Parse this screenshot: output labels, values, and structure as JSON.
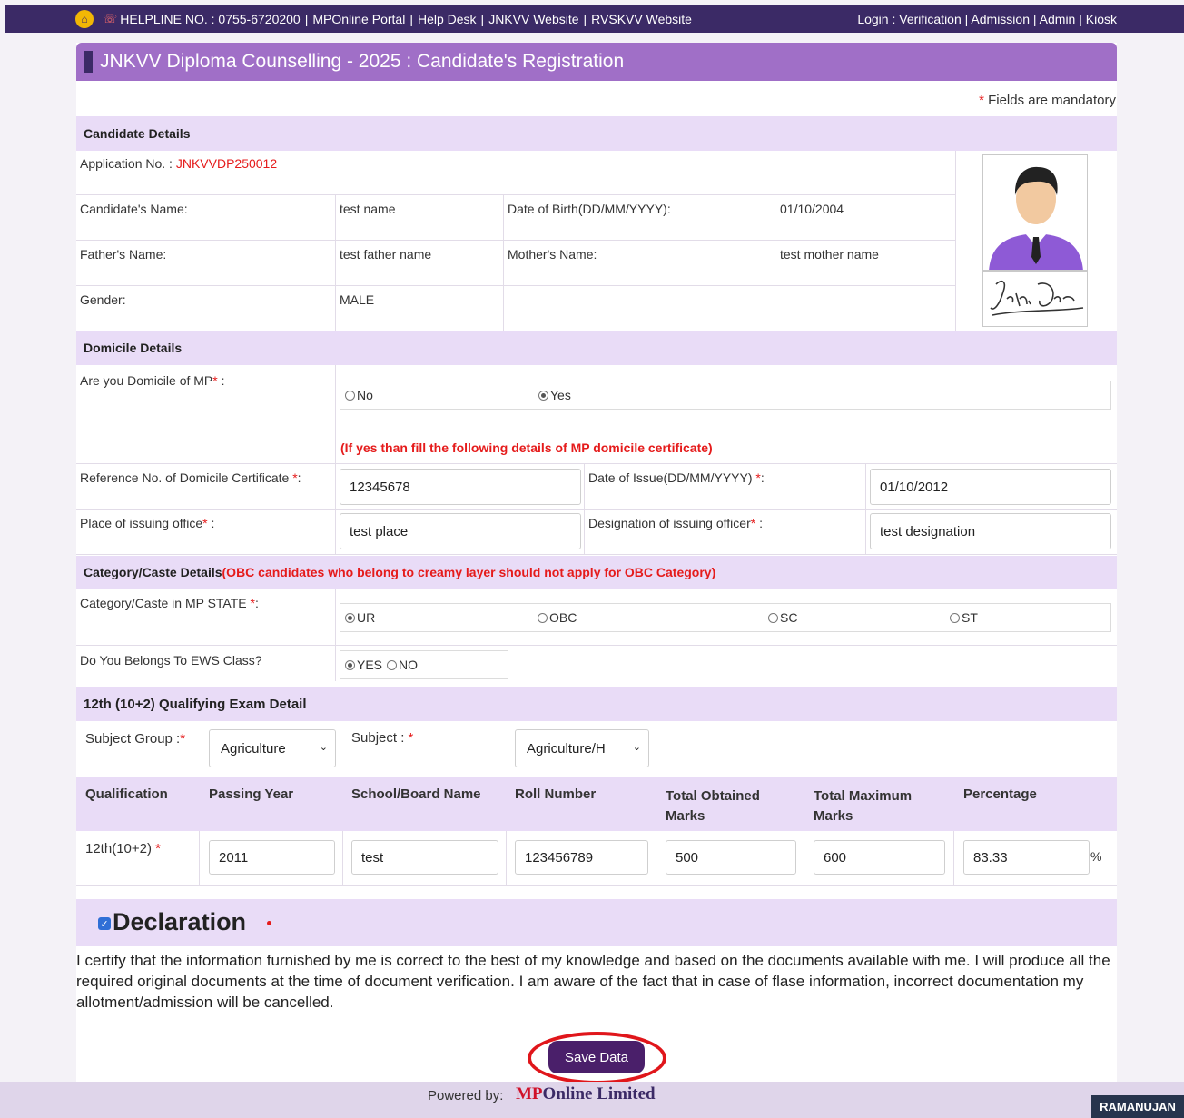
{
  "topbar": {
    "helpline": "HELPLINE NO. : 0755-6720200",
    "links": [
      "MPOnline Portal",
      "Help Desk",
      "JNKVV Website",
      "RVSKVV Website"
    ],
    "login_label": "Login :",
    "login_links": [
      "Verification",
      "Admission",
      "Admin",
      "Kiosk"
    ]
  },
  "page_title": "JNKVV Diploma Counselling - 2025 : Candidate's Registration",
  "mandatory_note": "Fields are mandatory",
  "candidate": {
    "section": "Candidate Details",
    "app_no_label": "Application No. :",
    "app_no": "JNKVVDP250012",
    "name_label": "Candidate's Name:",
    "name": "test name",
    "dob_label": "Date of Birth(DD/MM/YYYY):",
    "dob": "01/10/2004",
    "father_label": "Father's Name:",
    "father": "test father name",
    "mother_label": "Mother's Name:",
    "mother": "test mother name",
    "gender_label": "Gender:",
    "gender": "MALE",
    "signature": "John Doe"
  },
  "domicile": {
    "section": "Domicile Details",
    "question": "Are you Domicile of MP",
    "question_suffix": " :",
    "options": [
      "No",
      "Yes"
    ],
    "selected": "Yes",
    "note": "(If yes than fill the following details of MP domicile certificate)",
    "ref_label": "Reference No. of Domicile Certificate ",
    "ref_value": "12345678",
    "issue_label": "Date of Issue(DD/MM/YYYY) ",
    "issue_value": "01/10/2012",
    "place_label": "Place of issuing office",
    "place_value": "test place",
    "designation_label": "Designation of issuing officer",
    "designation_value": "test designation"
  },
  "category": {
    "section": "Category/Caste Details",
    "section_note": "(OBC candidates who belong to creamy layer should not apply for OBC Category)",
    "caste_label": "Category/Caste in MP STATE ",
    "options": [
      "UR",
      "OBC",
      "SC",
      "ST"
    ],
    "selected": "UR",
    "ews_label": "Do You Belongs To EWS Class?",
    "ews_options": [
      "YES",
      "NO"
    ],
    "ews_selected": "YES"
  },
  "exam": {
    "section": "12th (10+2) Qualifying Exam Detail",
    "subject_group_label": "Subject Group :",
    "subject_group_value": "Agriculture",
    "subject_label": "Subject : ",
    "subject_value": "Agriculture/H",
    "columns": [
      "Qualification",
      "Passing Year",
      "School/Board Name",
      "Roll Number",
      "Total Obtained Marks",
      "Total Maximum Marks",
      "Percentage"
    ],
    "row": {
      "qualification": "12th(10+2) ",
      "passing_year": "2011",
      "school": "test",
      "roll": "123456789",
      "obtained": "500",
      "maximum": "600",
      "percentage": "83.33",
      "pct_sign": "%"
    }
  },
  "declaration": {
    "title": "Declaration",
    "text": "I certify that the information furnished by me is correct to the best of my knowledge and based on the documents available with me. I will produce all the required original documents at the time of document verification. I am aware of the fact that in case of flase information, incorrect documentation my allotment/admission will be cancelled."
  },
  "save_label": "Save Data",
  "footer": {
    "powered": "Powered by:",
    "brand_mp": "MP",
    "brand_online": "Online Limited"
  },
  "user_badge": "RAMANUJAN",
  "colors": {
    "topbar": "#3b2a66",
    "title": "#a06fc7",
    "section": "#e9dcf7",
    "accent_red": "#e51b1b",
    "button": "#4a1f6a"
  },
  "icons": {
    "home": "home-icon",
    "phone": "phone-icon",
    "checkbox": "checkbox-checked-icon",
    "chevron": "chevron-down-icon"
  }
}
